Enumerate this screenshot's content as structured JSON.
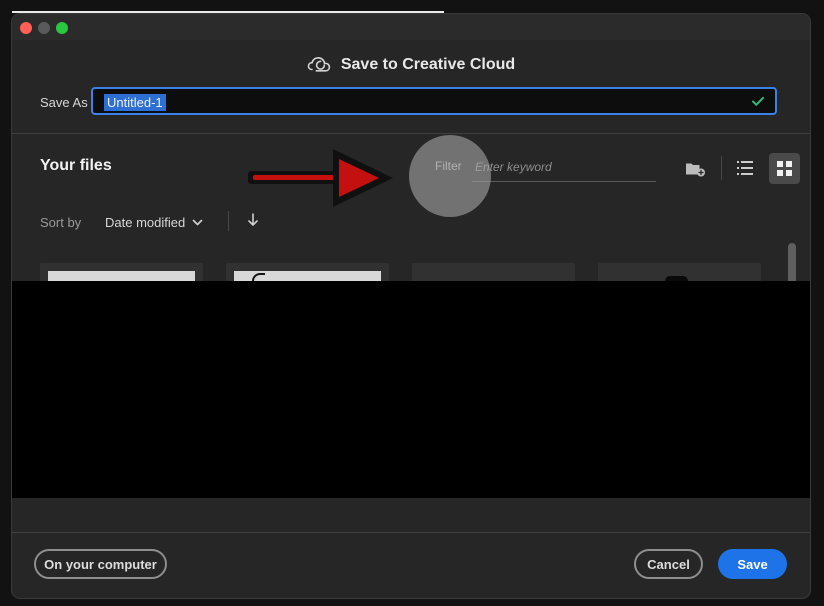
{
  "dialog": {
    "title": "Save to Creative Cloud"
  },
  "save_as": {
    "label": "Save As",
    "value": "Untitled-1"
  },
  "files": {
    "title": "Your files",
    "filter_label": "Filter",
    "filter_placeholder": "Enter keyword",
    "sort_label": "Sort by",
    "sort_value": "Date modified"
  },
  "footer": {
    "local_label": "On your computer",
    "cancel_label": "Cancel",
    "save_label": "Save"
  },
  "colors": {
    "accent": "#1f73e8",
    "field_border": "#3a82ea",
    "arrow": "#c51010",
    "success": "#2fb97a"
  },
  "icons": {
    "cloud": "creative-cloud-icon",
    "check": "check-icon",
    "folder_add": "folder-add-icon",
    "list_view": "list-view-icon",
    "grid_view": "grid-view-icon",
    "sort": "chevron-down-icon",
    "sort_order": "arrow-down-icon",
    "pointer": "red-arrow-icon"
  }
}
